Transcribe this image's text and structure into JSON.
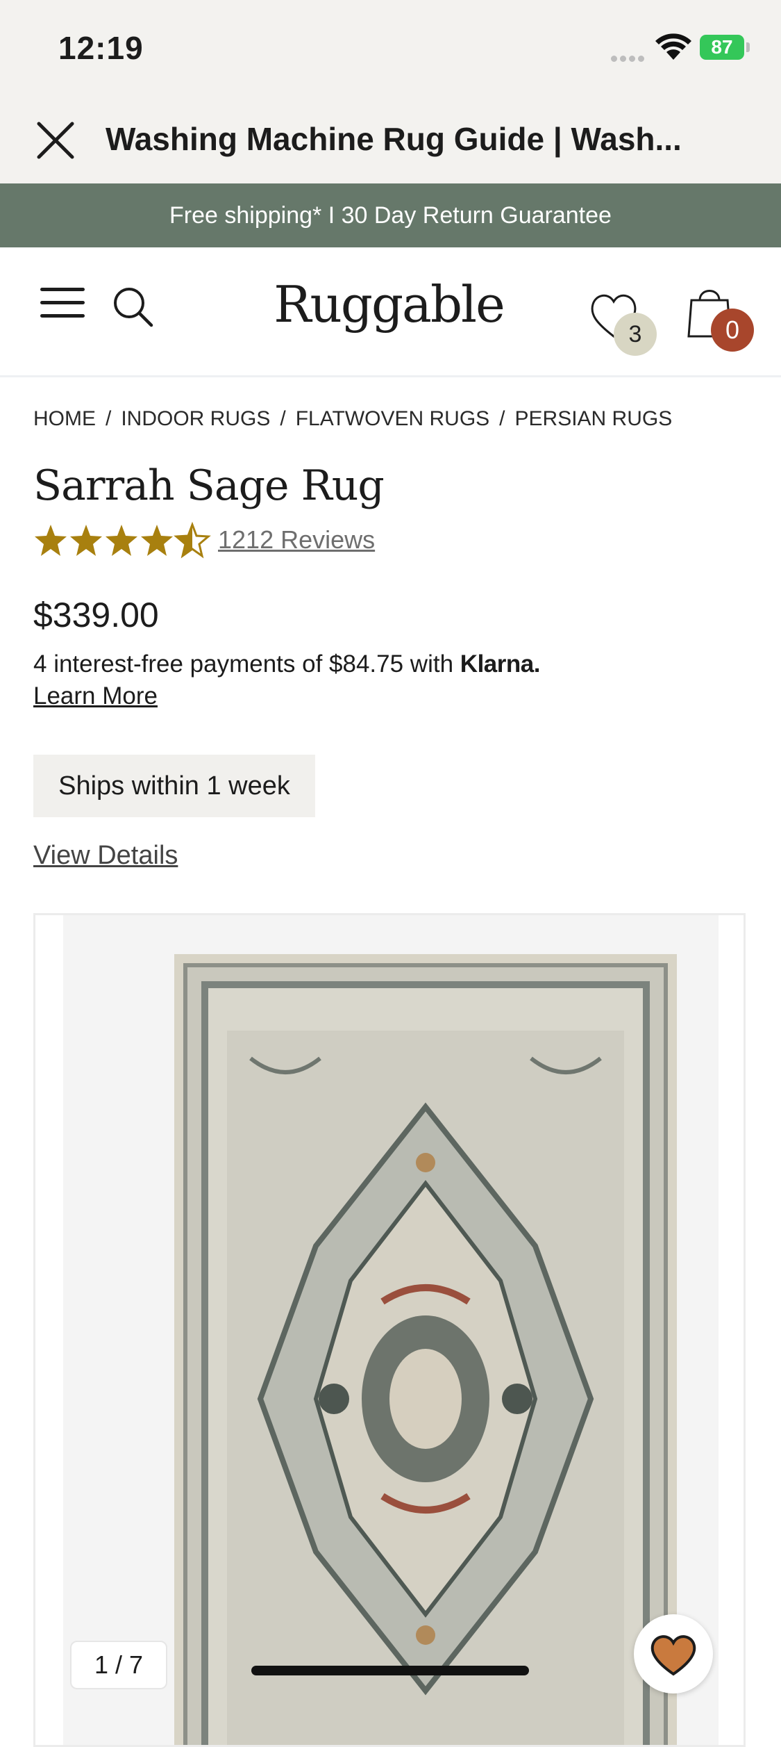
{
  "status_bar": {
    "time": "12:19",
    "battery": "87"
  },
  "browser": {
    "title": "Washing Machine Rug Guide | Wash..."
  },
  "promo": {
    "text": "Free shipping* I 30 Day Return Guarantee"
  },
  "header": {
    "logo": "Ruggable",
    "wishlist_count": "3",
    "cart_count": "0"
  },
  "breadcrumb": [
    "HOME",
    "INDOOR RUGS",
    "FLATWOVEN RUGS",
    "PERSIAN RUGS"
  ],
  "product": {
    "title": "Sarrah Sage Rug",
    "rating": 4.5,
    "reviews": "1212 Reviews",
    "price": "$339.00",
    "klarna_text": "4 interest-free payments of $84.75 with",
    "klarna_brand": "Klarna.",
    "learn_more": "Learn More",
    "ships": "Ships within 1 week",
    "view_details": "View Details"
  },
  "gallery": {
    "counter": "1 / 7"
  },
  "colors": {
    "promo_bg": "#66786a",
    "star": "#a8800f",
    "cart_badge": "#a8462c",
    "wish_badge": "#d8d6c3",
    "fav_heart": "#c97a3e"
  }
}
